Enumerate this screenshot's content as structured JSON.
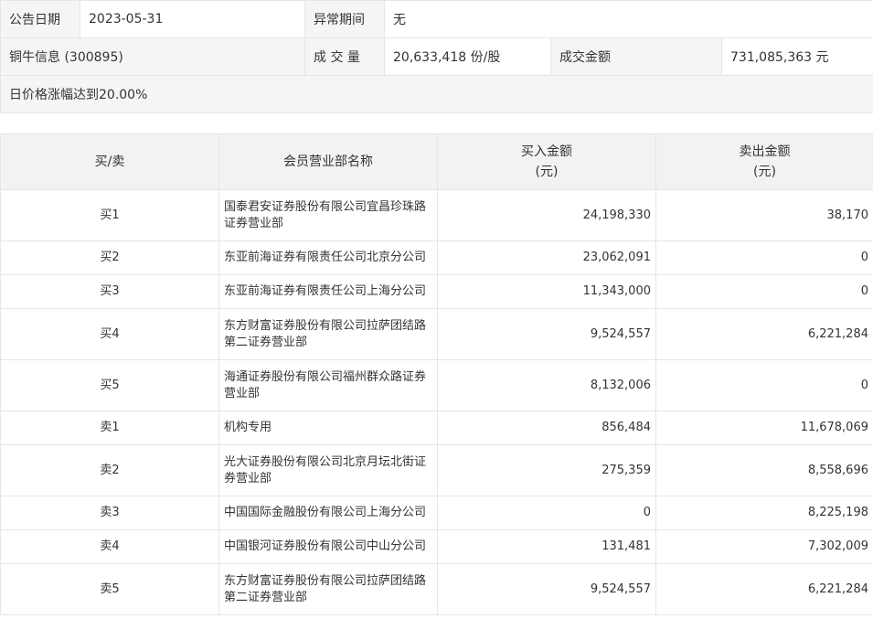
{
  "info": {
    "announce_date_label": "公告日期",
    "announce_date": "2023-05-31",
    "abnormal_period_label": "异常期间",
    "abnormal_period": "无",
    "stock": "铜牛信息 (300895)",
    "volume_label": "成 交 量",
    "volume": "20,633,418 份/股",
    "amount_label": "成交金额",
    "amount": "731,085,363 元",
    "reason": "日价格涨幅达到20.00%"
  },
  "table": {
    "headers": {
      "side": "买/卖",
      "member": "会员营业部名称",
      "buy_line1": "买入金额",
      "buy_line2": "(元)",
      "sell_line1": "卖出金额",
      "sell_line2": "(元)"
    },
    "rows": [
      {
        "side": "买1",
        "name": "国泰君安证券股份有限公司宜昌珍珠路证券营业部",
        "buy": "24,198,330",
        "sell": "38,170"
      },
      {
        "side": "买2",
        "name": "东亚前海证券有限责任公司北京分公司",
        "buy": "23,062,091",
        "sell": "0"
      },
      {
        "side": "买3",
        "name": "东亚前海证券有限责任公司上海分公司",
        "buy": "11,343,000",
        "sell": "0"
      },
      {
        "side": "买4",
        "name": "东方财富证券股份有限公司拉萨团结路第二证券营业部",
        "buy": "9,524,557",
        "sell": "6,221,284"
      },
      {
        "side": "买5",
        "name": "海通证券股份有限公司福州群众路证券营业部",
        "buy": "8,132,006",
        "sell": "0"
      },
      {
        "side": "卖1",
        "name": "机构专用",
        "buy": "856,484",
        "sell": "11,678,069"
      },
      {
        "side": "卖2",
        "name": "光大证券股份有限公司北京月坛北街证券营业部",
        "buy": "275,359",
        "sell": "8,558,696"
      },
      {
        "side": "卖3",
        "name": "中国国际金融股份有限公司上海分公司",
        "buy": "0",
        "sell": "8,225,198"
      },
      {
        "side": "卖4",
        "name": "中国银河证券股份有限公司中山分公司",
        "buy": "131,481",
        "sell": "7,302,009"
      },
      {
        "side": "卖5",
        "name": "东方财富证券股份有限公司拉萨团结路第二证券营业部",
        "buy": "9,524,557",
        "sell": "6,221,284"
      }
    ]
  }
}
